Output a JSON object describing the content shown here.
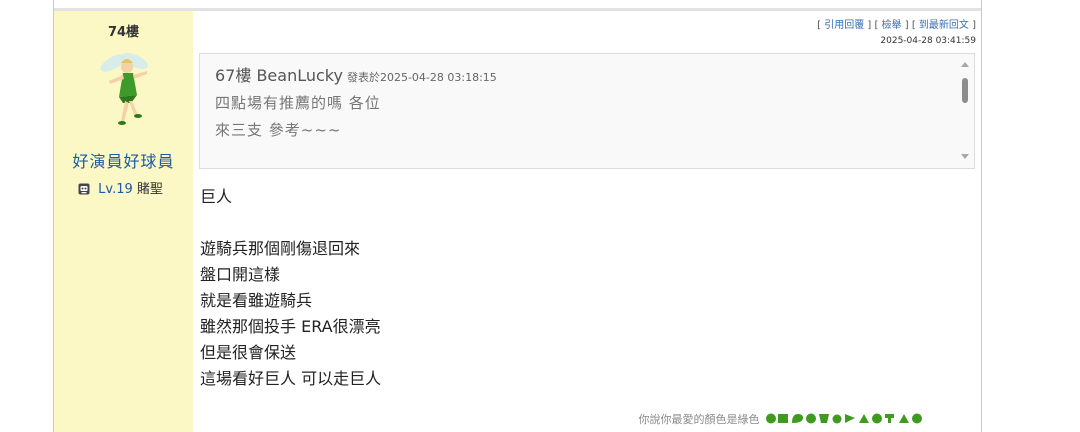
{
  "post": {
    "floor": "74樓",
    "author": {
      "nickname": "好演員好球員",
      "level": "Lv.19",
      "title": "賭聖",
      "level_icon": "gamepad-badge-icon",
      "avatar_icon": "green-fairy-avatar"
    },
    "actions": {
      "quote_reply": "引用回覆",
      "report": "檢舉",
      "latest_reply": "到最新回文"
    },
    "timestamp": "2025-04-28 03:41:59",
    "quote": {
      "header": "67樓 BeanLucky",
      "meta": "發表於2025-04-28 03:18:15",
      "lines": [
        "四點場有推薦的嗎 各位",
        "來三支 參考~~~"
      ]
    },
    "body": {
      "first_line": "巨人",
      "lines": [
        "遊騎兵那個剛傷退回來",
        "盤口開這樣",
        "就是看雖遊騎兵",
        "雖然那個投手 ERA很漂亮",
        "但是很會保送",
        "這場看好巨人 可以走巨人"
      ]
    },
    "signature": {
      "text": "你說你最愛的顏色是綠色",
      "icon_color": "#3f9a20"
    }
  },
  "colors": {
    "sidebar_bg": "#fbf8c6",
    "link": "#1a5aa8",
    "quote_bg": "#f9f9f9"
  }
}
